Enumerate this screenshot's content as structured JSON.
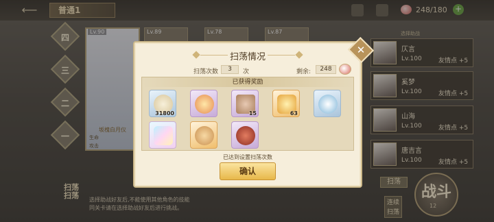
{
  "header": {
    "back_icon": "back-arrow-icon",
    "stage_title": "普通1",
    "stamina": "248/180",
    "stamina_icon": "rice-ball-icon"
  },
  "floors": [
    "四",
    "三",
    "二",
    "一"
  ],
  "hero": {
    "level": "Lv.90",
    "name": "坂槐白月仪",
    "stat1": "生命",
    "stat2": "攻击"
  },
  "team_levels": [
    "Lv.89",
    "Lv.78",
    "Lv.87"
  ],
  "left_bottom": {
    "sweep_stage": "扫荡\n扫荡",
    "info_line1": "选择助战好友后,不能使用其他角色的技能",
    "info_line2": "同关卡请在选择助战好友后进行挑战。"
  },
  "right_panel": {
    "label": "选择助战",
    "friends": [
      {
        "name": "仄言",
        "level": "Lv.100",
        "affinity": "友情点 +5"
      },
      {
        "name": "奚梦",
        "level": "Lv.100",
        "affinity": "友情点 +5"
      },
      {
        "name": "山海",
        "level": "Lv.100",
        "affinity": "友情点 +5"
      },
      {
        "name": "唐吉言",
        "level": "Lv.100",
        "affinity": "友情点 +5"
      }
    ],
    "sweep_label": "扫荡",
    "repeat_label": "连续\n扫荡",
    "battle_label": "战斗",
    "battle_cost": "12"
  },
  "dialog": {
    "title": "扫荡情况",
    "count_label": "扫荡次数",
    "count_value": "3",
    "count_unit": "次",
    "remain_label": "剩余:",
    "remain_value": "248",
    "reward_header": "已获得奖励",
    "items_row1": [
      {
        "icon": "dumpling-icon",
        "qty": "31800",
        "rarity": "blue"
      },
      {
        "icon": "dessert-icon",
        "qty": "",
        "rarity": "purple"
      },
      {
        "icon": "tray-icon",
        "qty": "15",
        "rarity": "purple"
      },
      {
        "icon": "gem-icon",
        "qty": "63",
        "rarity": "orange"
      },
      {
        "icon": "chef-icon",
        "qty": "",
        "rarity": "blue"
      }
    ],
    "items_row2": [
      {
        "icon": "rainbow-shard-icon",
        "qty": "",
        "rarity": "rainbow"
      },
      {
        "icon": "cookie-icon",
        "qty": "",
        "rarity": "orange"
      },
      {
        "icon": "pot-icon",
        "qty": "",
        "rarity": "purple"
      }
    ],
    "done_text": "已达到设置扫荡次数",
    "confirm_label": "确认",
    "close_icon": "close-icon"
  }
}
